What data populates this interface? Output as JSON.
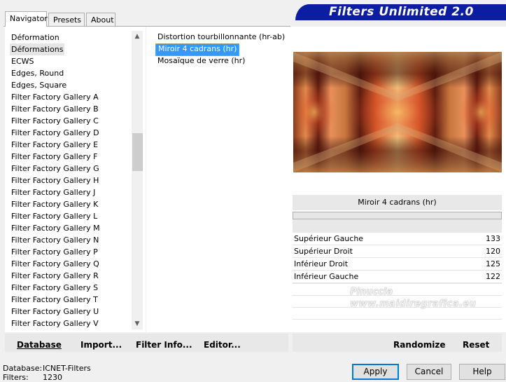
{
  "tabs": [
    {
      "label": "Navigator",
      "active": true
    },
    {
      "label": "Presets",
      "active": false
    },
    {
      "label": "About",
      "active": false
    }
  ],
  "banner": {
    "title": "Filters Unlimited 2.0",
    "color": "#0b1ea2"
  },
  "categories": {
    "items": [
      "Déformation",
      "Déformations",
      "ECWS",
      "Edges, Round",
      "Edges, Square",
      "Filter Factory Gallery A",
      "Filter Factory Gallery B",
      "Filter Factory Gallery C",
      "Filter Factory Gallery D",
      "Filter Factory Gallery E",
      "Filter Factory Gallery F",
      "Filter Factory Gallery G",
      "Filter Factory Gallery H",
      "Filter Factory Gallery J",
      "Filter Factory Gallery K",
      "Filter Factory Gallery L",
      "Filter Factory Gallery M",
      "Filter Factory Gallery N",
      "Filter Factory Gallery P",
      "Filter Factory Gallery Q",
      "Filter Factory Gallery R",
      "Filter Factory Gallery S",
      "Filter Factory Gallery T",
      "Filter Factory Gallery U",
      "Filter Factory Gallery V"
    ],
    "selected": "Déformations"
  },
  "filters": {
    "items": [
      "Distortion tourbillonnante (hr-ab)",
      "Miroir 4 cadrans (hr)",
      "Mosaïque de verre (hr)"
    ],
    "selected": "Miroir 4 cadrans (hr)"
  },
  "params": {
    "filter_name": "Miroir 4 cadrans (hr)",
    "rows": [
      {
        "label": "Supérieur Gauche",
        "value": "133"
      },
      {
        "label": "Supérieur Droit",
        "value": "120"
      },
      {
        "label": "Inférieur Droit",
        "value": "125"
      },
      {
        "label": "Inférieur Gauche",
        "value": "122"
      }
    ]
  },
  "watermark": {
    "line1": "Pinuccia",
    "line2": "www.maidiregrafica.eu"
  },
  "toolbar_left": {
    "database": "Database",
    "import": "Import...",
    "filter_info": "Filter Info...",
    "editor": "Editor..."
  },
  "toolbar_right": {
    "randomize": "Randomize",
    "reset": "Reset"
  },
  "status": {
    "database_label": "Database:",
    "database_value": "ICNET-Filters",
    "filters_label": "Filters:",
    "filters_value": "1230"
  },
  "buttons": {
    "apply": "Apply",
    "cancel": "Cancel",
    "help": "Help"
  },
  "colors": {
    "selection": "#3399ff",
    "preview_dark": "#5a1a0c",
    "preview_light": "#e8c08a",
    "preview_accent": "#e05020"
  }
}
